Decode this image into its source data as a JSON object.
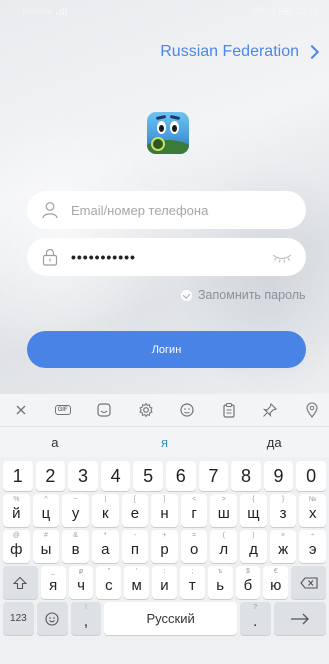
{
  "status_bar": {
    "carrier": "Beeline",
    "battery": "96 %",
    "time": "11:58"
  },
  "header": {
    "country": "Russian Federation"
  },
  "login_form": {
    "email_placeholder": "Email/номер телефона",
    "password_masked": "•••••••••••",
    "remember_label": "Запомнить пароль",
    "login_button": "Логин"
  },
  "keyboard": {
    "toolbar_icons": [
      "close-icon",
      "gif-icon",
      "sticker-icon",
      "settings-icon",
      "emoji-icon",
      "clipboard-icon",
      "pin-icon",
      "location-icon"
    ],
    "toolbar_gif_label": "GIF",
    "suggestions": [
      "а",
      "я",
      "да"
    ],
    "number_row": [
      "1",
      "2",
      "3",
      "4",
      "5",
      "6",
      "7",
      "8",
      "9",
      "0"
    ],
    "row1": [
      {
        "sup": "%",
        "main": "й"
      },
      {
        "sup": "^",
        "main": "ц"
      },
      {
        "sup": "~",
        "main": "у"
      },
      {
        "sup": "|",
        "main": "к"
      },
      {
        "sup": "[",
        "main": "е"
      },
      {
        "sup": "]",
        "main": "н"
      },
      {
        "sup": "<",
        "main": "г"
      },
      {
        "sup": ">",
        "main": "ш"
      },
      {
        "sup": "{",
        "main": "щ"
      },
      {
        "sup": "}",
        "main": "з"
      },
      {
        "sup": "№",
        "main": "х"
      }
    ],
    "row2": [
      {
        "sup": "@",
        "main": "ф"
      },
      {
        "sup": "#",
        "main": "ы"
      },
      {
        "sup": "&",
        "main": "в"
      },
      {
        "sup": "*",
        "main": "а"
      },
      {
        "sup": "-",
        "main": "п"
      },
      {
        "sup": "+",
        "main": "р"
      },
      {
        "sup": "=",
        "main": "о"
      },
      {
        "sup": "(",
        "main": "л"
      },
      {
        "sup": ")",
        "main": "д"
      },
      {
        "sup": "×",
        "main": "ж"
      },
      {
        "sup": "÷",
        "main": "э"
      }
    ],
    "row3": [
      {
        "sup": "_",
        "main": "я"
      },
      {
        "sup": "₽",
        "main": "ч"
      },
      {
        "sup": "\"",
        "main": "с"
      },
      {
        "sup": "'",
        "main": "м"
      },
      {
        "sup": ":",
        "main": "и"
      },
      {
        "sup": ";",
        "main": "т"
      },
      {
        "sup": "ъ",
        "main": "ь"
      },
      {
        "sup": "$",
        "main": "б"
      },
      {
        "sup": "€",
        "main": "ю"
      }
    ],
    "bottom": {
      "mode_key": "123",
      "comma_sup": "!",
      "comma": ",",
      "space": "Русский",
      "period_sup": "?",
      "period": "."
    }
  }
}
